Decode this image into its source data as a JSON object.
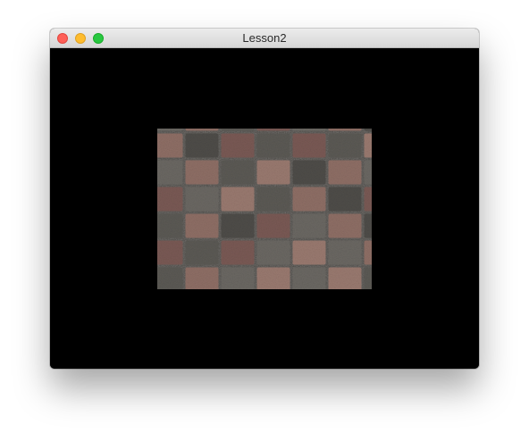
{
  "window": {
    "title": "Lesson2",
    "controls": {
      "close_icon": "close-icon",
      "minimize_icon": "minimize-icon",
      "zoom_icon": "zoom-icon"
    }
  },
  "canvas": {
    "background_color": "#000000",
    "content": "textured-quad",
    "texture": {
      "pattern": "paving-stones",
      "colors": [
        "#8f6f66",
        "#5c5a55",
        "#7a5a55",
        "#6b6863",
        "#9a7a70",
        "#4f4d49"
      ]
    }
  }
}
